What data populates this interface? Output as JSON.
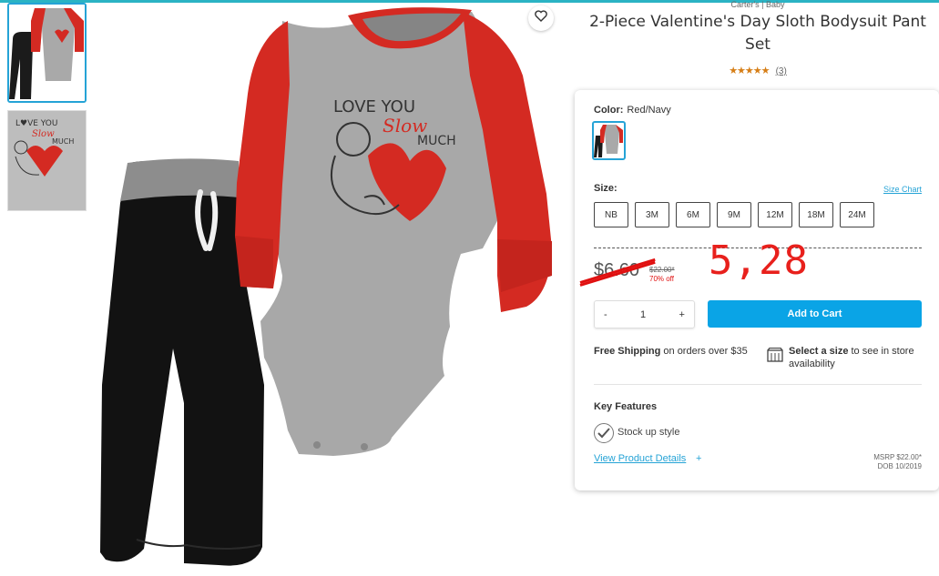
{
  "product": {
    "brand": "Carter's | Baby",
    "title": "2-Piece Valentine's Day Sloth Bodysuit Pant Set",
    "stars": "★★★★★",
    "review_count": "(3)",
    "image_text": {
      "line1": "LOVE YOU",
      "line2": "Slow",
      "line3": "MUCH"
    }
  },
  "color": {
    "label": "Color:",
    "value": "Red/Navy"
  },
  "size": {
    "label": "Size:",
    "chart_link": "Size Chart",
    "options": [
      "NB",
      "3M",
      "6M",
      "9M",
      "12M",
      "18M",
      "24M"
    ]
  },
  "price": {
    "current": "$6.60",
    "msrp": "$22.00*",
    "percent_off": "70% off",
    "annotation": "5,28"
  },
  "quantity": {
    "minus": "-",
    "value": "1",
    "plus": "+"
  },
  "cart": {
    "button_label": "Add to Cart"
  },
  "shipping": {
    "bold": "Free Shipping",
    "text": " on orders over $35"
  },
  "store": {
    "bold": "Select a size",
    "text": " to see in store availability"
  },
  "features": {
    "heading": "Key Features",
    "items": [
      "Stock up style"
    ],
    "details_link": "View Product Details",
    "details_plus": "+",
    "msrp_line": "MSRP $22.00*",
    "dob_line": "DOB 10/2019"
  },
  "colors": {
    "accent": "#0aa4e6",
    "annotation_red": "#e8201c",
    "shirt_red": "#d42a22",
    "body_gray": "#a8a8a8"
  }
}
